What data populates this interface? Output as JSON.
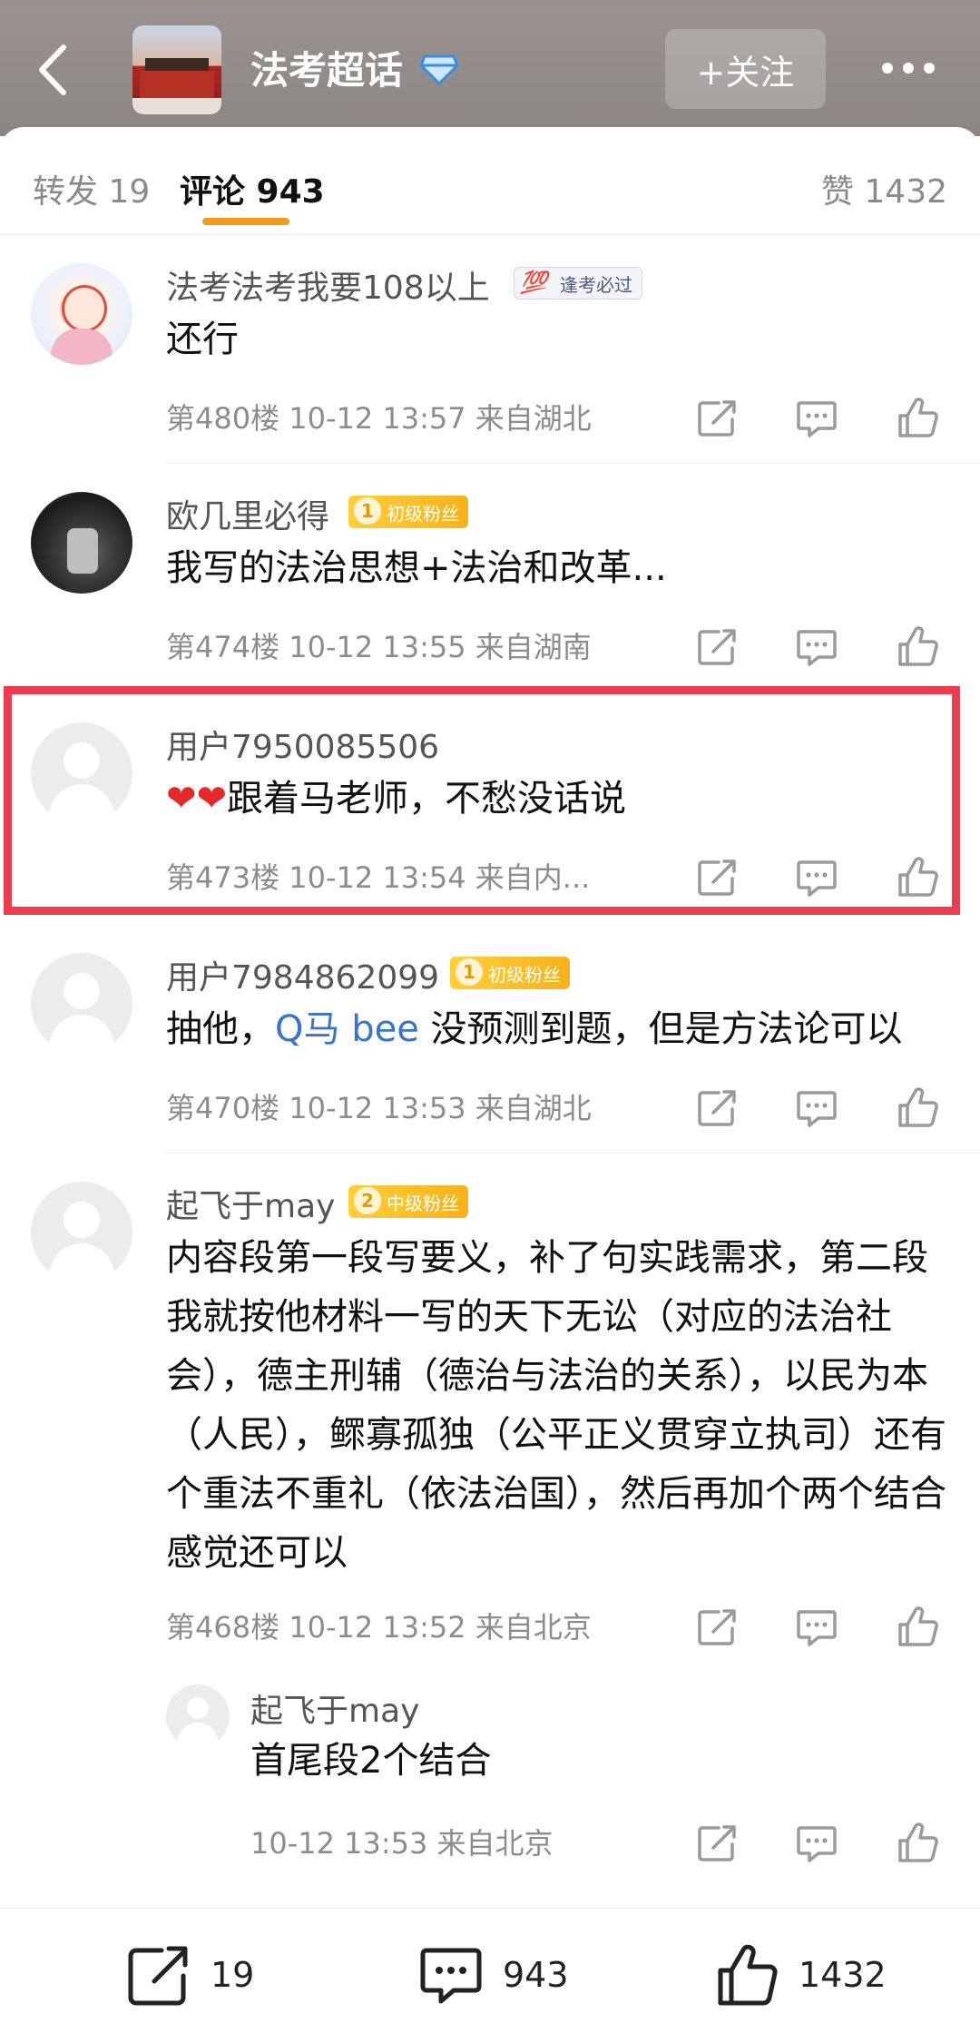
{
  "header": {
    "topic_title": "法考超话",
    "follow_label": "+关注"
  },
  "tabs": {
    "repost": "转发 19",
    "comment": "评论 943",
    "like": "赞 1432"
  },
  "comments": [
    {
      "username": "法考法考我要108以上",
      "badge": "逢考必过",
      "badge_icon": "💯",
      "content": "还行",
      "meta": "第480楼 10-12 13:57 来自湖北"
    },
    {
      "username": "欧几里必得",
      "badge": "初级粉丝",
      "badge_level": "1",
      "content": "我写的法治思想+法治和改革...",
      "meta": "第474楼 10-12 13:55 来自湖南"
    },
    {
      "username": "用户7950085506",
      "emoji": "❤❤",
      "content": "跟着马老师，不愁没话说",
      "meta": "第473楼 10-12 13:54 来自内..."
    },
    {
      "username": "用户7984862099",
      "badge": "初级粉丝",
      "badge_level": "1",
      "content_pre": "抽他，",
      "mention": "Q马 bee",
      "content_post": " 没预测到题，但是方法论可以",
      "meta": "第470楼 10-12 13:53 来自湖北"
    },
    {
      "username": "起飞于may",
      "badge": "中级粉丝",
      "badge_level": "2",
      "content": "内容段第一段写要义，补了句实践需求，第二段我就按他材料一写的天下无讼（对应的法治社会），德主刑辅（德治与法治的关系），以民为本（人民），鳏寡孤独（公平正义贯穿立执司）还有个重法不重礼（依法治国），然后再加个两个结合 感觉还可以",
      "meta": "第468楼 10-12 13:52 来自北京"
    }
  ],
  "reply": {
    "username": "起飞于may",
    "content": "首尾段2个结合",
    "meta": "10-12 13:53 来自北京"
  },
  "bottom_bar": {
    "repost_count": "19",
    "comment_count": "943",
    "like_count": "1432"
  },
  "colors": {
    "accent_orange": "#f29b1f",
    "highlight_red": "#ee3c4e",
    "mention_blue": "#3874c9"
  }
}
